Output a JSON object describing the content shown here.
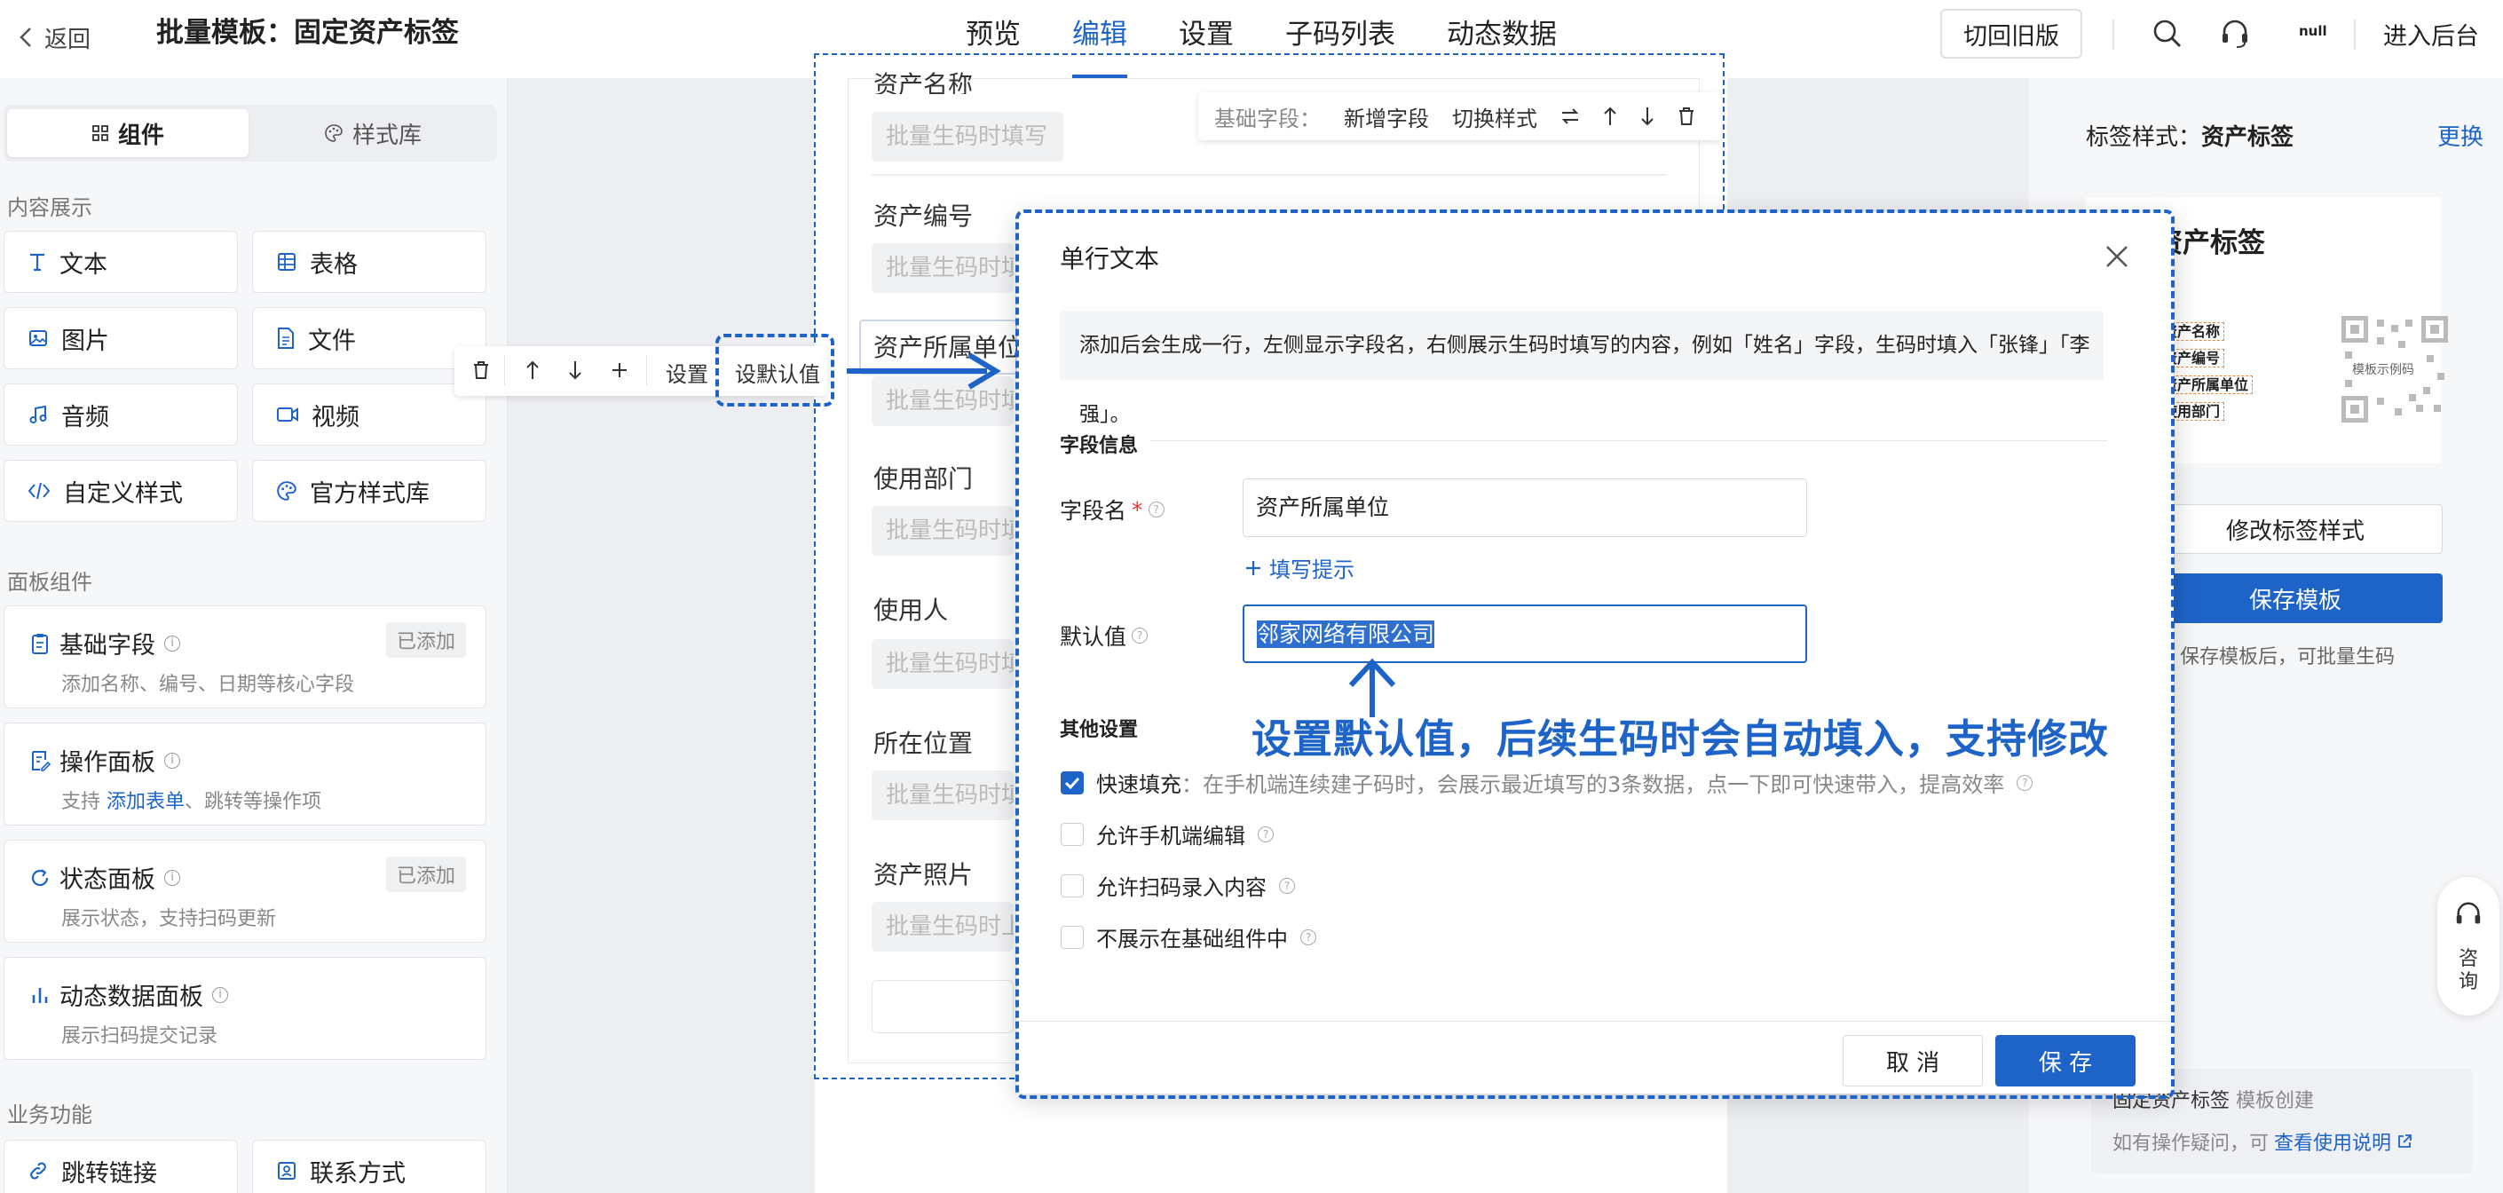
{
  "header": {
    "back_label": "返回",
    "title": "批量模板：固定资产标签",
    "nav": [
      "预览",
      "编辑",
      "设置",
      "子码列表",
      "动态数据"
    ],
    "active_nav": "编辑",
    "old_version_label": "切回旧版",
    "user_short": "null",
    "enter_admin_label": "进入后台"
  },
  "sidebar": {
    "tabs": [
      "组件",
      "样式库"
    ],
    "section_content": "内容展示",
    "content_items": [
      "文本",
      "表格",
      "图片",
      "文件",
      "音频",
      "视频",
      "自定义样式",
      "官方样式库"
    ],
    "section_panel": "面板组件",
    "panel_items": [
      {
        "title": "基础字段",
        "desc": "添加名称、编号、日期等核心字段",
        "badge": "已添加"
      },
      {
        "title": "操作面板",
        "desc_prefix": "支持 ",
        "desc_link": "添加表单",
        "desc_suffix": "、跳转等操作项"
      },
      {
        "title": "状态面板",
        "desc": "展示状态，支持扫码更新",
        "badge": "已添加"
      },
      {
        "title": "动态数据面板",
        "desc": "展示扫码提交记录"
      }
    ],
    "section_business": "业务功能",
    "business_items": [
      "跳转链接",
      "联系方式"
    ]
  },
  "canvas": {
    "fields": [
      {
        "label": "资产名称",
        "placeholder": "批量生码时填写"
      },
      {
        "label": "资产编号",
        "placeholder": "批量生码时填写"
      },
      {
        "label": "资产所属单位",
        "placeholder": "批量生码时填写"
      },
      {
        "label": "使用部门",
        "placeholder": "批量生码时填写"
      },
      {
        "label": "使用人",
        "placeholder": "批量生码时填写"
      },
      {
        "label": "所在位置",
        "placeholder": "批量生码时填写"
      },
      {
        "label": "资产照片",
        "placeholder": "批量生码时上传"
      }
    ],
    "floating_toolbar": {
      "label": "基础字段：",
      "add_field": "新增字段",
      "switch_style": "切换样式"
    },
    "row_toolbar": {
      "settings": "设置",
      "set_default": "设默认值"
    }
  },
  "right_panel": {
    "style_label": "标签样式：",
    "style_name": "资产标签",
    "change_label": "更换",
    "preview_title": "资产标签",
    "preview_fields": [
      "资产名称",
      "资产编号",
      "资产所属单位",
      "使用部门"
    ],
    "preview_left_chars": [
      "称",
      "号",
      "号",
      "门"
    ],
    "qr_caption": "模板示例码",
    "modify_style_btn": "修改标签样式",
    "save_template_btn": "保存模板",
    "save_hint": "保存模板后，可批量生码",
    "footer_line1_name": "固定资产标签",
    "footer_line1_suffix": " 模板创建",
    "footer_line2_prefix": "如有操作疑问，可",
    "footer_line2_link": "查看使用说明",
    "consult_label": "咨询"
  },
  "modal": {
    "title": "单行文本",
    "notice": "添加后会生成一行，左侧显示字段名，右侧展示生码时填写的内容，例如「姓名」字段，生码时填入「张锋」「李强」。",
    "section_field_info": "字段信息",
    "field_name_label": "字段名",
    "field_name_value": "资产所属单位",
    "fill_hint_label": "填写提示",
    "default_label": "默认值",
    "default_value": "邻家网络有限公司",
    "section_other": "其他设置",
    "options": [
      {
        "label": "快速填充",
        "desc": "：在手机端连续建子码时，会展示最近填写的3条数据，点一下即可快速带入，提高效率",
        "checked": true
      },
      {
        "label": "允许手机端编辑",
        "checked": false
      },
      {
        "label": "允许扫码录入内容",
        "checked": false
      },
      {
        "label": "不展示在基础组件中",
        "checked": false
      }
    ],
    "cancel_label": "取 消",
    "save_label": "保 存"
  },
  "annotation": {
    "text": "设置默认值，后续生码时会自动填入，支持修改"
  },
  "colors": {
    "accent": "#1e64c8",
    "annotation": "#1e64c8",
    "tag_dash": "#e88a3c"
  }
}
